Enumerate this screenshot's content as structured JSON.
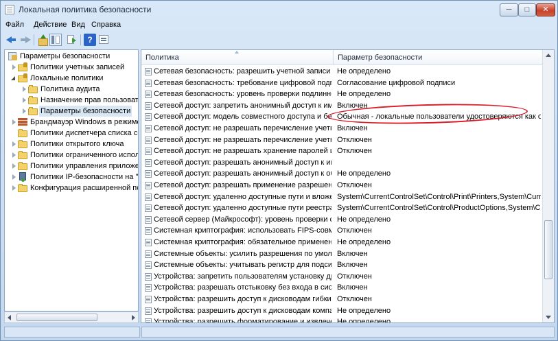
{
  "window": {
    "title": "Локальная политика безопасности",
    "minimize_symbol": "─",
    "maximize_symbol": "□",
    "close_symbol": "✕"
  },
  "menu": {
    "file": "Файл",
    "action": "Действие",
    "view": "Вид",
    "help": "Справка"
  },
  "toolbar": {
    "help_symbol": "?"
  },
  "tree": [
    {
      "label": "Параметры безопасности",
      "icon": "security-settings-root-icon"
    },
    {
      "label": "Политики учетных записей",
      "icon": "folder-icon"
    },
    {
      "label": "Локальные политики",
      "icon": "folder-icon"
    },
    {
      "label": "Политика аудита",
      "icon": "folder-icon"
    },
    {
      "label": "Назначение прав пользователя",
      "icon": "folder-icon"
    },
    {
      "label": "Параметры безопасности",
      "icon": "folder-icon"
    },
    {
      "label": "Брандмауэр Windows в режиме пов",
      "icon": "firewall-icon"
    },
    {
      "label": "Политики диспетчера списка сетей",
      "icon": "folder-icon"
    },
    {
      "label": "Политики открытого ключа",
      "icon": "folder-icon"
    },
    {
      "label": "Политики ограниченного использо",
      "icon": "folder-icon"
    },
    {
      "label": "Политики управления приложения",
      "icon": "folder-icon"
    },
    {
      "label": "Политики IP-безопасности на \"Лока",
      "icon": "ipsec-icon"
    },
    {
      "label": "Конфигурация расширенной полит",
      "icon": "folder-icon"
    }
  ],
  "list": {
    "col_policy": "Политика",
    "col_setting": "Параметр безопасности",
    "rows": [
      {
        "policy": "Сетевая безопасность: разрешить учетной записи локал...",
        "setting": "Не определено"
      },
      {
        "policy": "Сетевая безопасность: требование цифровой подписи дл...",
        "setting": "Согласование цифровой подписи"
      },
      {
        "policy": "Сетевая безопасность: уровень проверки подлинности L...",
        "setting": "Не определено"
      },
      {
        "policy": "Сетевой доступ: запретить анонимный доступ к именова...",
        "setting": "Включен"
      },
      {
        "policy": "Сетевой доступ: модель совместного доступа и безопасн...",
        "setting": "Обычная - локальные пользователи удостоверяются как о..."
      },
      {
        "policy": "Сетевой доступ: не разрешать перечисление учетных зап...",
        "setting": "Включен"
      },
      {
        "policy": "Сетевой доступ: не разрешать перечисление учетных запи...",
        "setting": "Отключен"
      },
      {
        "policy": "Сетевой доступ: не разрешать хранение паролей или уче...",
        "setting": "Отключен"
      },
      {
        "policy": "Сетевой доступ: разрешать анонимный доступ к именов...",
        "setting": ""
      },
      {
        "policy": "Сетевой доступ: разрешать анонимный доступ к общим ...",
        "setting": "Не определено"
      },
      {
        "policy": "Сетевой доступ: разрешать применение разрешений \"Дл...",
        "setting": "Отключен"
      },
      {
        "policy": "Сетевой доступ: удаленно доступные пути и вложенные ...",
        "setting": "System\\CurrentControlSet\\Control\\Print\\Printers,System\\Curr..."
      },
      {
        "policy": "Сетевой доступ: удаленно доступные пути реестра",
        "setting": "System\\CurrentControlSet\\Control\\ProductOptions,System\\C..."
      },
      {
        "policy": "Сетевой сервер (Майкрософт): уровень проверки сервер...",
        "setting": "Не определено"
      },
      {
        "policy": "Системная криптография: использовать FIPS-совместим...",
        "setting": "Отключен"
      },
      {
        "policy": "Системная криптография: обязательное применение си...",
        "setting": "Не определено"
      },
      {
        "policy": "Системные объекты: усилить разрешения по умолчани...",
        "setting": "Включен"
      },
      {
        "policy": "Системные объекты: учитывать регистр для подсистем, ...",
        "setting": "Включен"
      },
      {
        "policy": "Устройства: запретить пользователям установку драйвер...",
        "setting": "Отключен"
      },
      {
        "policy": "Устройства: разрешать отстыковку без входа в систему",
        "setting": "Включен"
      },
      {
        "policy": "Устройства: разрешить доступ к дисководам гибких диск...",
        "setting": "Отключен"
      },
      {
        "policy": "Устройства: разрешить доступ к дисководам компакт-ди...",
        "setting": "Не определено"
      },
      {
        "policy": "Устройства: разрешить форматирование и извлечение с...",
        "setting": "Не определено"
      }
    ]
  },
  "colors": {
    "annotation": "#d81d2b",
    "selection": "#d9e6f4"
  }
}
